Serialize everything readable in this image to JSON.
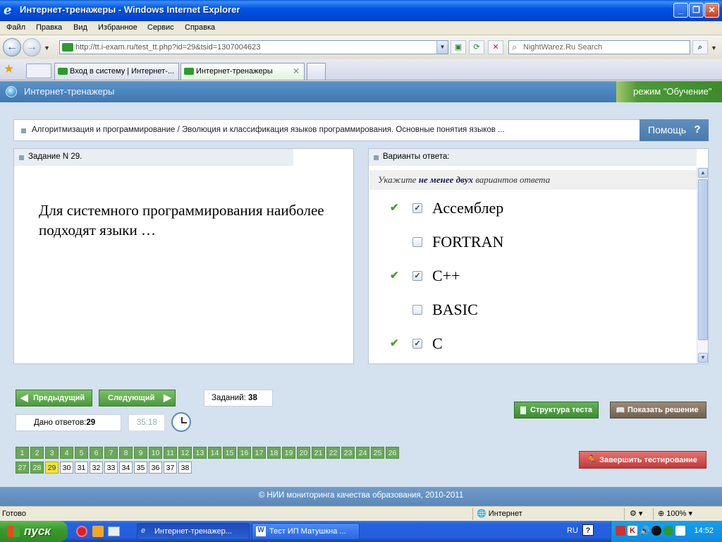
{
  "window": {
    "title": "Интернет-тренажеры - Windows Internet Explorer",
    "controls": [
      "_",
      "❐",
      "✕"
    ]
  },
  "menu": [
    "Файл",
    "Правка",
    "Вид",
    "Избранное",
    "Сервис",
    "Справка"
  ],
  "address": {
    "url": "http://tt.i-exam.ru/test_tt.php?id=29&tsid=1307004623",
    "search_placeholder": "NightWarez.Ru Search"
  },
  "tabs": [
    {
      "label": "Вход в систему | Интернет-..."
    },
    {
      "label": "Интернет-тренажеры",
      "active": true
    }
  ],
  "app": {
    "name": "Интернет-тренажеры",
    "mode": "режим \"Обучение\""
  },
  "breadcrumb": "Алгоритмизация и программирование / Эволюция и классификация языков программирования. Основные понятия языков ...",
  "help": {
    "label": "Помощь",
    "icon": "?"
  },
  "question": {
    "header": "Задание N 29.",
    "text": "Для системного программирования наиболее подходят языки …"
  },
  "answers": {
    "header": "Варианты ответа:",
    "instruction_pre": "Укажите ",
    "instruction_bold": "не менее двух",
    "instruction_post": " вариантов ответа",
    "options": [
      {
        "label": "Ассемблер",
        "checked": true,
        "correct": true
      },
      {
        "label": "FORTRAN",
        "checked": false,
        "correct": false
      },
      {
        "label": "C++",
        "checked": true,
        "correct": true
      },
      {
        "label": "BASIC",
        "checked": false,
        "correct": false
      },
      {
        "label": "C",
        "checked": true,
        "correct": true
      }
    ]
  },
  "nav": {
    "prev": "Предыдущий",
    "next": "Следующий",
    "tasks_label": "Заданий:",
    "tasks_count": "38",
    "answered_label": "Дано ответов:",
    "answered_count": "29",
    "timer": "35:18",
    "structure": "Структура теста",
    "show_solution": "Показать решение",
    "finish": "Завершить тестирование"
  },
  "question_grid": {
    "total": 38,
    "current": 29,
    "answered_upto": 28
  },
  "footer": "© НИИ мониторинга качества образования, 2010-2011",
  "status": {
    "left": "Готово",
    "zone": "Интернет",
    "zoom": "100%"
  },
  "taskbar": {
    "start": "пуск",
    "items": [
      {
        "label": "Интернет-тренажер...",
        "active": true
      },
      {
        "label": "Тест ИП Матушкна ...",
        "active": false
      }
    ],
    "lang": "RU",
    "clock": "14:52"
  },
  "colors": {
    "app_header": "#4a82bb",
    "content_bg": "#d4e1ee",
    "done_question": "#6aa85a",
    "current_question": "#f0e43a",
    "finish_button": "#d24f4d"
  }
}
